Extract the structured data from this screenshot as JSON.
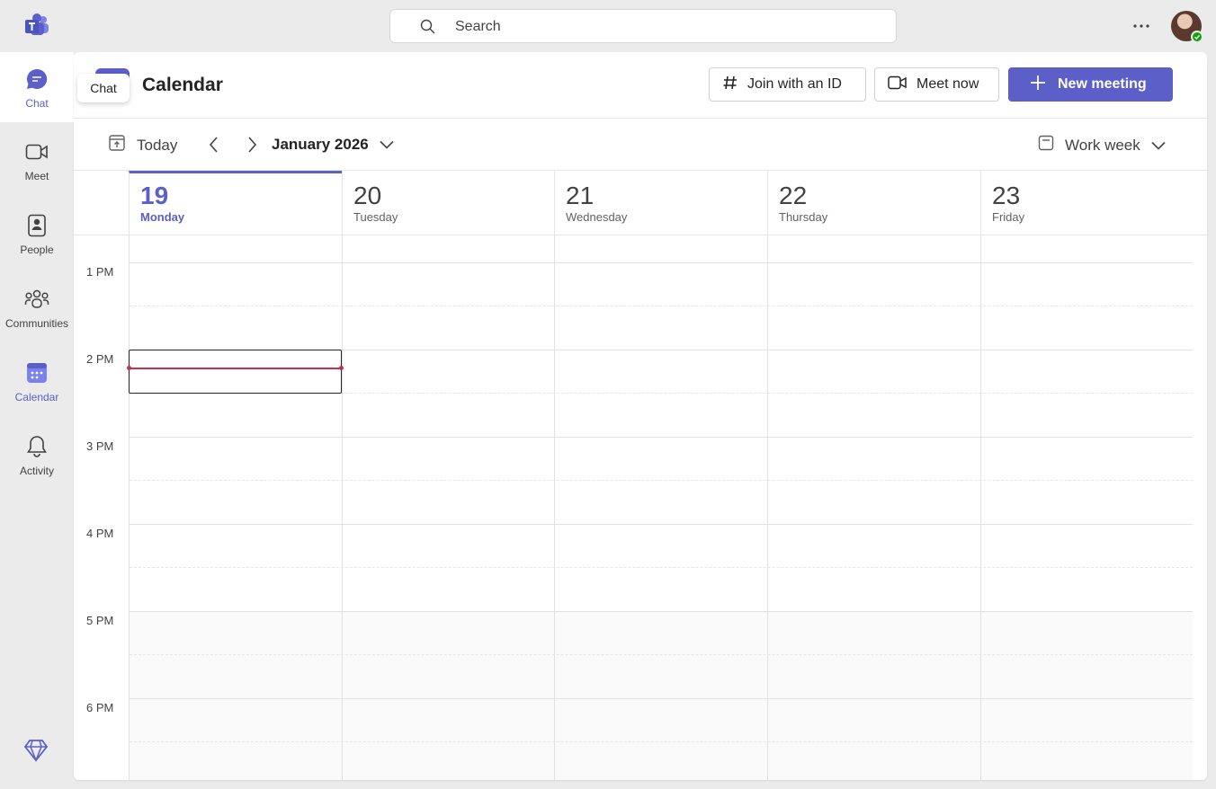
{
  "search": {
    "placeholder": "Search"
  },
  "rail": {
    "items": [
      {
        "label": "Chat"
      },
      {
        "label": "Meet"
      },
      {
        "label": "People"
      },
      {
        "label": "Communities"
      },
      {
        "label": "Calendar"
      },
      {
        "label": "Activity"
      }
    ],
    "tooltip": "Chat"
  },
  "header": {
    "title": "Calendar",
    "join_label": "Join with an ID",
    "meet_label": "Meet now",
    "new_label": "New meeting"
  },
  "toolbar": {
    "today_label": "Today",
    "month_label": "January 2026",
    "view_label": "Work week"
  },
  "days": [
    {
      "num": "19",
      "name": "Monday"
    },
    {
      "num": "20",
      "name": "Tuesday"
    },
    {
      "num": "21",
      "name": "Wednesday"
    },
    {
      "num": "22",
      "name": "Thursday"
    },
    {
      "num": "23",
      "name": "Friday"
    }
  ],
  "times": [
    "1 PM",
    "2 PM",
    "3 PM",
    "4 PM",
    "5 PM",
    "6 PM"
  ],
  "colors": {
    "accent": "#5b5fc7",
    "now": "#c4314b"
  }
}
